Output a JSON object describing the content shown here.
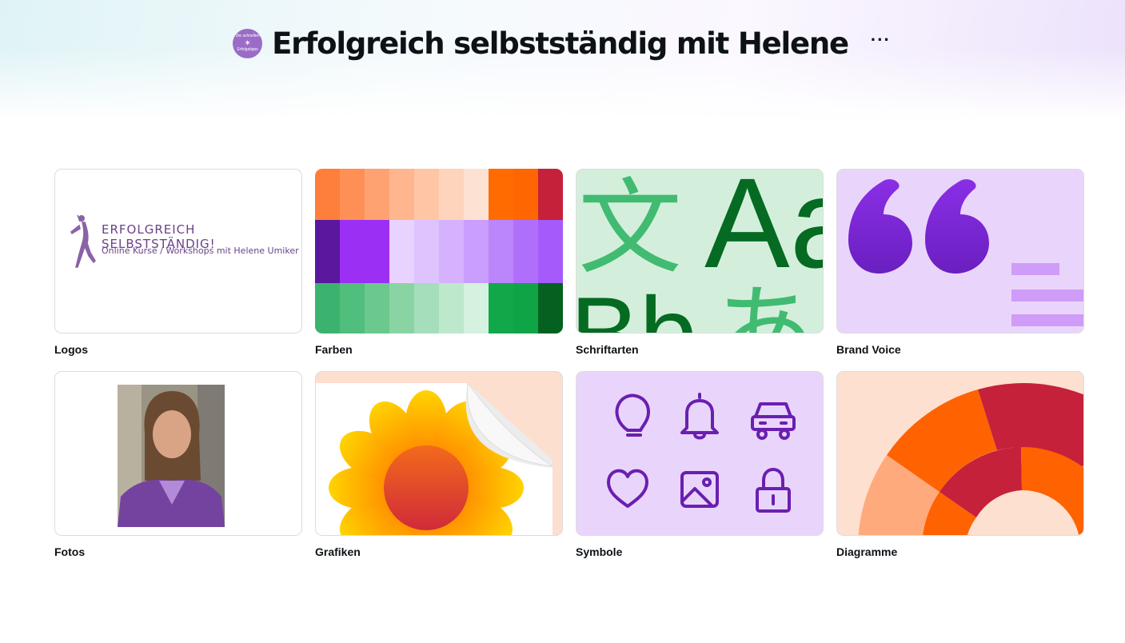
{
  "header": {
    "title": "Erfolgreich selbstständig mit Helene",
    "more_label": "···",
    "avatar_text_top": "Die schnellen",
    "avatar_text_bottom": "Erfolgstipps"
  },
  "cards": [
    {
      "label": "Logos",
      "icon": "logo-thumbnail"
    },
    {
      "label": "Farben",
      "icon": "color-palette-thumbnail"
    },
    {
      "label": "Schriftarten",
      "icon": "fonts-thumbnail"
    },
    {
      "label": "Brand Voice",
      "icon": "quote-thumbnail"
    },
    {
      "label": "Fotos",
      "icon": "photo-thumbnail"
    },
    {
      "label": "Grafiken",
      "icon": "sticker-thumbnail"
    },
    {
      "label": "Symbole",
      "icon": "icons-thumbnail"
    },
    {
      "label": "Diagramme",
      "icon": "chart-thumbnail"
    }
  ],
  "logo": {
    "line1": "ERFOLGREICH SELBSTSTÄNDIG!",
    "line2": "Online Kurse / Workshops mit Helene Umiker"
  },
  "fonts_sample": {
    "glyph1": "文",
    "glyph2": "Aa",
    "glyph3": "Bb",
    "glyph4": "あ"
  },
  "palette": {
    "row1": [
      "#fd7f3b",
      "#fe9055",
      "#fea271",
      "#ffb58d",
      "#ffc6a6",
      "#fed4bc",
      "#fde1d3",
      "#ff6b00",
      "#ff6500",
      "#c5213a"
    ],
    "row2": [
      "#5a189e",
      "#9c2ff4",
      "#9c2ff4",
      "#e8d3fe",
      "#dfc3fe",
      "#d5b1fe",
      "#c99efc",
      "#bc86fb",
      "#b06ffb",
      "#a55bfa"
    ],
    "row3": [
      "#3bb36e",
      "#50be7c",
      "#6bc98d",
      "#8ad4a3",
      "#a4debb",
      "#bde8cc",
      "#d5f1df",
      "#11a84a",
      "#0fa547",
      "#046120"
    ]
  },
  "colors": {
    "voice_quote": "#7b27d6",
    "icon_stroke": "#6a1fb0",
    "font_dark": "#056b22",
    "font_light": "#42bb72"
  }
}
